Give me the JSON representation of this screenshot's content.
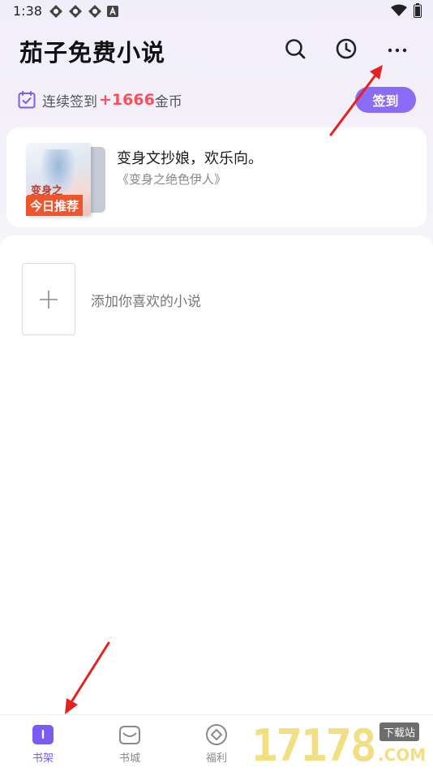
{
  "status_bar": {
    "time": "1:38"
  },
  "header": {
    "title": "茄子免费小说"
  },
  "signin": {
    "prefix": "连续签到",
    "coins": "+1666",
    "unit": "金币",
    "button_label": "签到"
  },
  "recommendation": {
    "badge": "今日推荐",
    "cover_title": "变身之",
    "text": "变身文抄娘，欢乐向。",
    "book_title": "《变身之绝色伊人》"
  },
  "shelf": {
    "add_label": "添加你喜欢的小说"
  },
  "nav": {
    "items": [
      {
        "label": "书架",
        "icon": "bookshelf-icon",
        "active": true
      },
      {
        "label": "书城",
        "icon": "bookstore-icon",
        "active": false
      },
      {
        "label": "福利",
        "icon": "welfare-icon",
        "active": false
      }
    ]
  },
  "watermark": {
    "number": "17178",
    "tag": "下载站",
    "suffix": ".COM"
  },
  "colors": {
    "accent": "#8b6cf6",
    "coins": "#ff4d5a",
    "badge": "#f0542d",
    "arrow": "#e8201e"
  }
}
